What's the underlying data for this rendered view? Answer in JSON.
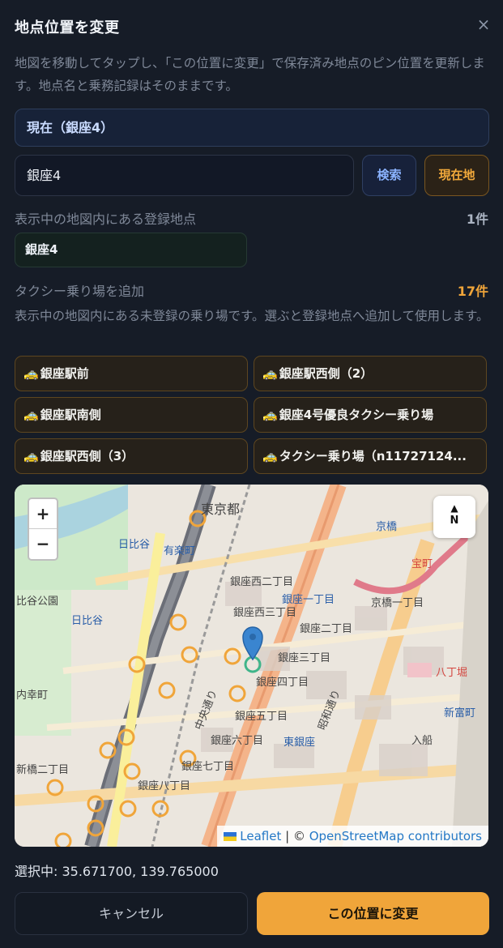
{
  "modal": {
    "title": "地点位置を変更",
    "close_symbol": "×",
    "description": "地図を移動してタップし、「この位置に変更」で保存済み地点のピン位置を更新します。地点名と乗務記録はそのままです。"
  },
  "current": {
    "label": "現在（銀座4）"
  },
  "search": {
    "value": "銀座4",
    "search_button": "検索",
    "location_button": "現在地"
  },
  "registered": {
    "label": "表示中の地図内にある登録地点",
    "count": "1件",
    "items": [
      "銀座4"
    ]
  },
  "taxi_stands": {
    "label": "タクシー乗り場を追加",
    "count": "17件",
    "note": "表示中の地図内にある未登録の乗り場です。選ぶと登録地点へ追加して使用します。",
    "icon": "taxi-icon",
    "icon_glyph": "🚕",
    "items": [
      "銀座駅前",
      "銀座駅西側（2）",
      "銀座駅南側",
      "銀座4号優良タクシー乗り場",
      "銀座駅西側（3）",
      "タクシー乗り場（n11727124..."
    ]
  },
  "map": {
    "zoom_in": "+",
    "zoom_out": "−",
    "compass_arrow": "▲",
    "compass_label": "N",
    "attribution_leaflet": "Leaflet",
    "attribution_sep": " | © ",
    "attribution_osm": "OpenStreetMap contributors",
    "place_labels": [
      "東京都",
      "日比谷",
      "有楽町",
      "日比谷",
      "比谷公園",
      "銀座西二丁目",
      "銀座西三丁目",
      "銀座一丁目",
      "銀座二丁目",
      "銀座三丁目",
      "銀座四丁目",
      "銀座五丁目",
      "銀座六丁目",
      "銀座七丁目",
      "銀座八丁目",
      "東銀座",
      "京橋",
      "宝町",
      "新富町",
      "内幸町",
      "新橋二丁目",
      "中央通り",
      "昭和通り",
      "八丁堀",
      "京橋一丁目",
      "入船"
    ]
  },
  "selected": {
    "text": "選択中: 35.671700, 139.765000"
  },
  "footer": {
    "cancel": "キャンセル",
    "apply": "この位置に変更"
  },
  "colors": {
    "accent": "#f0a53a",
    "blue": "#8bb3ff",
    "background": "#161c27"
  }
}
